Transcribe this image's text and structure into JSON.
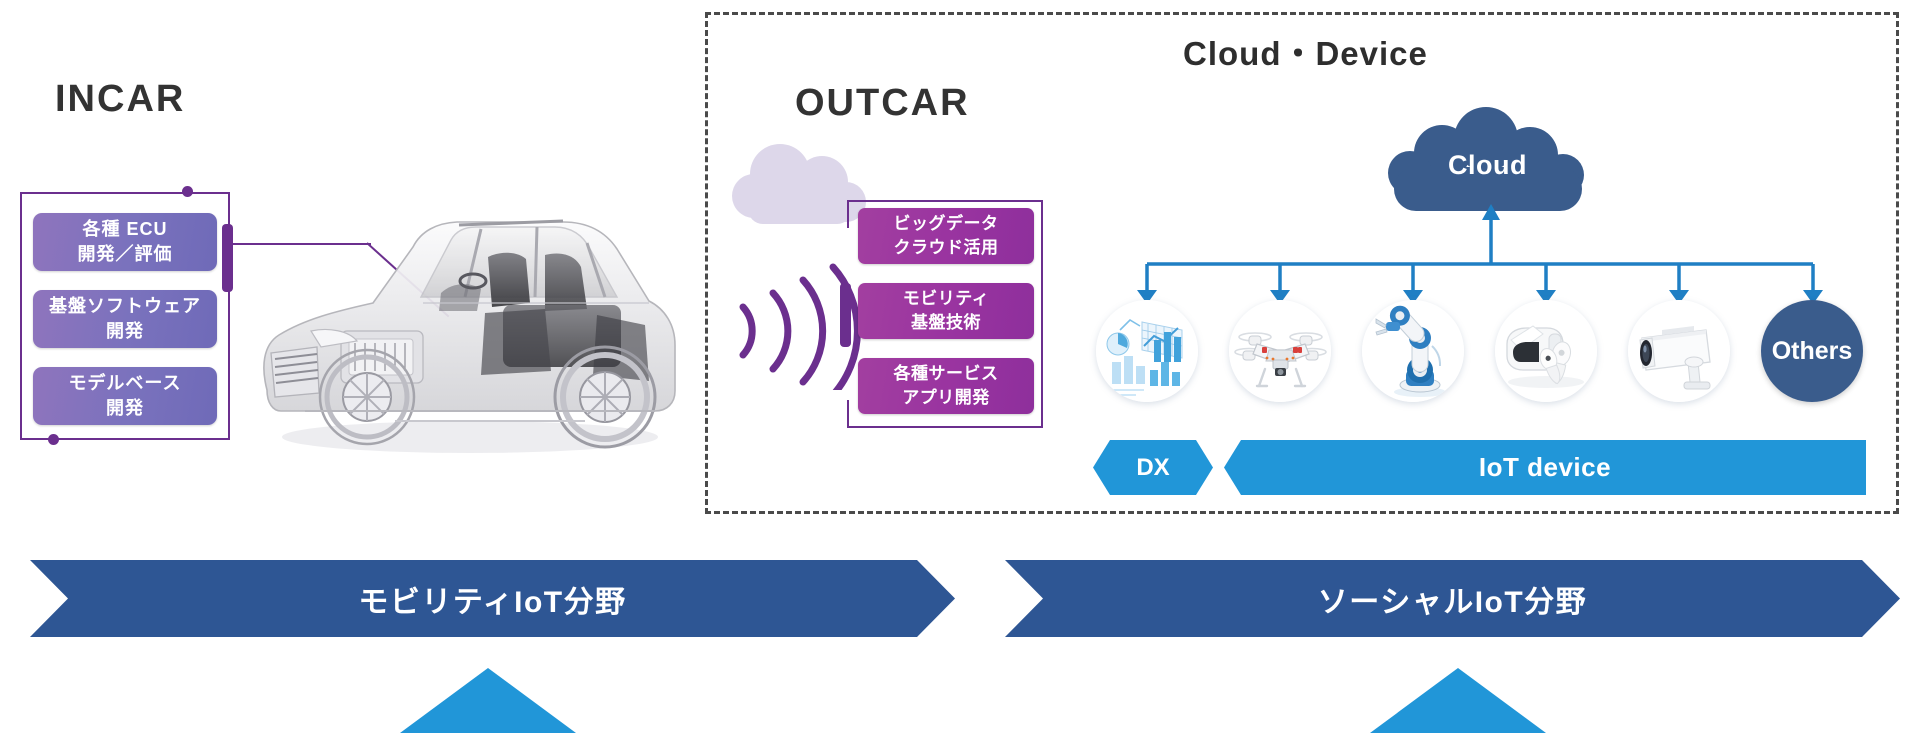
{
  "headings": {
    "incar": "INCAR",
    "outcar": "OUTCAR",
    "cloud_device": "Cloud・Device"
  },
  "incar": {
    "boxes": [
      {
        "label": "各種 ECU\n開発／評価",
        "name": "ecu-development-evaluation"
      },
      {
        "label": "基盤ソフトウェア\n開発",
        "name": "platform-software-development"
      },
      {
        "label": "モデルベース\n開発",
        "name": "model-based-development"
      }
    ],
    "marker_name": "car-ecu-target-marker",
    "vehicle_name": "cutaway-vehicle-illustration"
  },
  "outcar": {
    "boxes": [
      {
        "label": "ビッグデータ\nクラウド活用",
        "name": "big-data-cloud-utilization"
      },
      {
        "label": "モビリティ\n基盤技術",
        "name": "mobility-platform-technology"
      },
      {
        "label": "各種サービス\nアプリ開発",
        "name": "service-application-development"
      }
    ],
    "cloud_icon": "cloud-icon",
    "waves_icon": "wireless-signal-icon"
  },
  "cloud_device": {
    "cloud_label": "Cloud",
    "others_label": "Others",
    "devices": [
      {
        "name": "data-analytics-icon",
        "caption": "data visualization"
      },
      {
        "name": "drone-icon",
        "caption": "drone"
      },
      {
        "name": "robot-arm-icon",
        "caption": "industrial robot arm"
      },
      {
        "name": "vr-headset-icon",
        "caption": "VR headset and controllers"
      },
      {
        "name": "security-camera-icon",
        "caption": "security camera"
      }
    ],
    "banners": {
      "dx": "DX",
      "iot": "IoT device"
    }
  },
  "fields": {
    "left": "モビリティIoT分野",
    "right": "ソーシャルIoT分野"
  },
  "colors": {
    "purple": "#6b2f8e",
    "purple_box_start": "#8f74bd",
    "purple_box_end": "#6f6ab8",
    "magenta_box_start": "#a23fa0",
    "magenta_box_end": "#8e2f9c",
    "light_blue": "#2196d8",
    "dark_blue": "#2e5694",
    "cloud_blue": "#3a5c8c",
    "dashed_border": "#4a4a4a",
    "heading_text": "#333333"
  }
}
